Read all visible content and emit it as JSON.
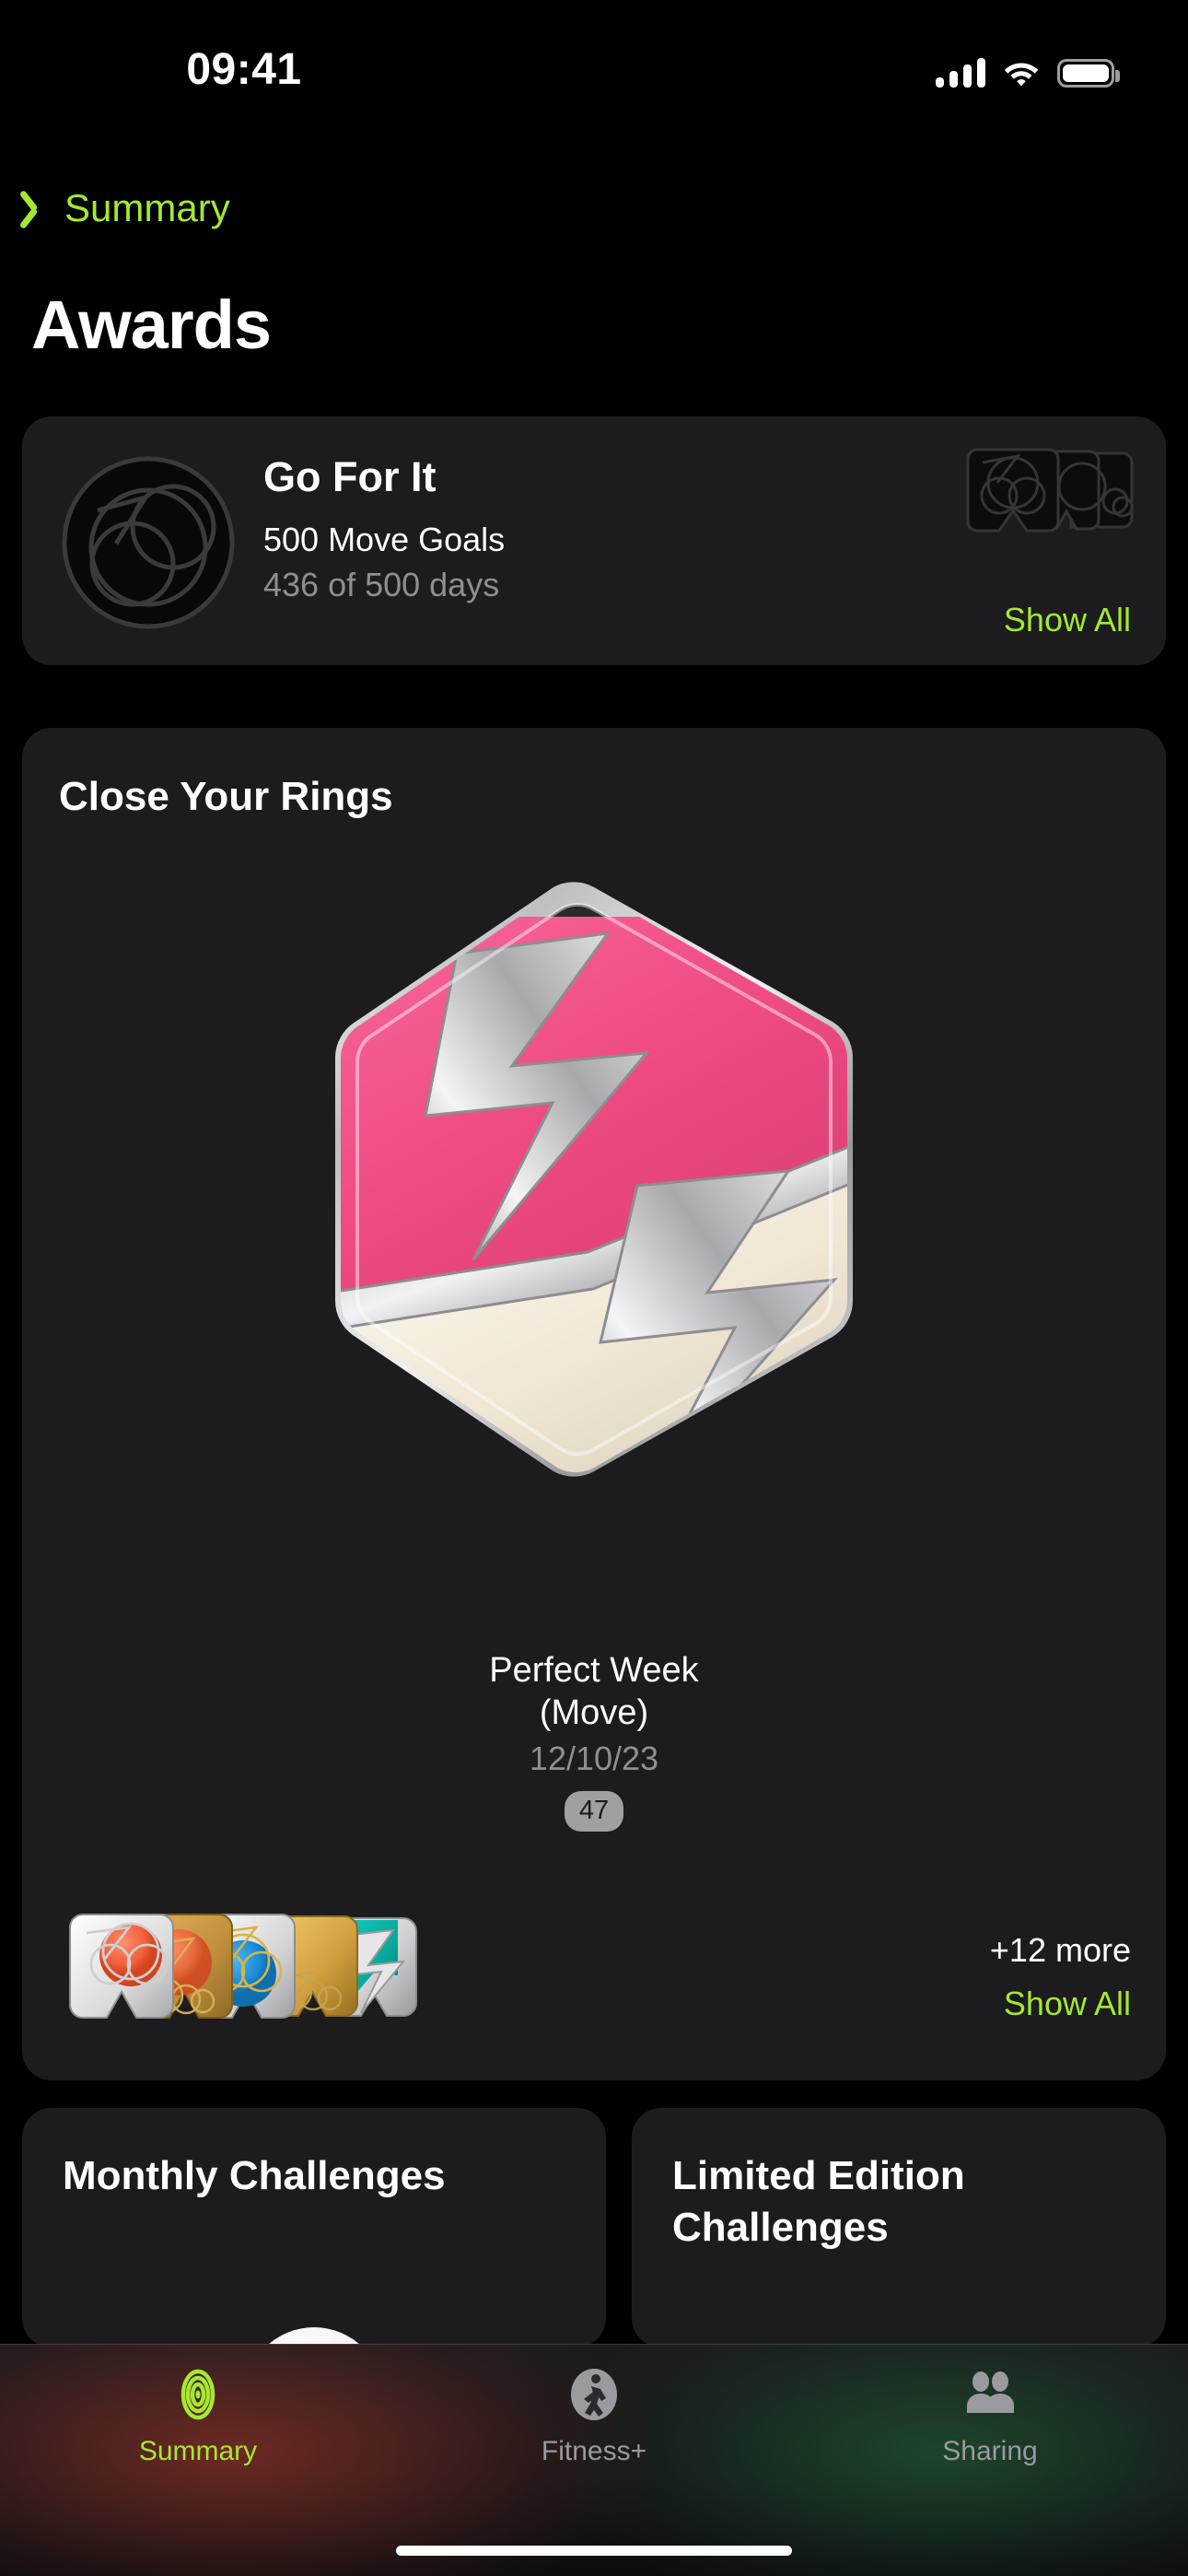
{
  "status_bar": {
    "time": "09:41",
    "cellular_icon": "cellular-bars-icon",
    "wifi_icon": "wifi-icon",
    "battery_icon": "battery-full-icon"
  },
  "nav": {
    "back_label": "Summary",
    "back_icon": "chevron-left-icon",
    "title": "Awards"
  },
  "go_for_it": {
    "badge_icon": "move-goal-circles-badge-icon",
    "title": "Go For It",
    "subtitle": "500 Move Goals",
    "progress": "436 of 500 days",
    "locked_stack_icon": "locked-awards-stack-icon",
    "show_all_label": "Show All"
  },
  "close_your_rings": {
    "title": "Close Your Rings",
    "hero": {
      "badge_icon": "perfect-week-move-hexagon-badge-icon",
      "name_line1": "Perfect Week",
      "name_line2": "(Move)",
      "date": "12/10/23",
      "count": "47"
    },
    "mini_stack_icon": "award-mini-stack-icon",
    "more_label": "+12 more",
    "show_all_label": "Show All"
  },
  "challenges": {
    "monthly": {
      "title": "Monthly Challenges",
      "peek_icon": "challenge-badge-peek-icon"
    },
    "limited": {
      "title": "Limited Edition Challenges"
    }
  },
  "tab_bar": {
    "tabs": [
      {
        "label": "Summary",
        "icon": "activity-rings-icon",
        "active": true
      },
      {
        "label": "Fitness+",
        "icon": "fitness-plus-runner-icon",
        "active": false
      },
      {
        "label": "Sharing",
        "icon": "people-sharing-icon",
        "active": false
      }
    ]
  },
  "colors": {
    "accent_green": "#A5E831",
    "card_bg": "#1C1C1E",
    "screen_bg": "#000000",
    "secondary_text": "#8E8E93",
    "badge_pink": "#EE4C83",
    "badge_cream": "#EDE6D2"
  }
}
